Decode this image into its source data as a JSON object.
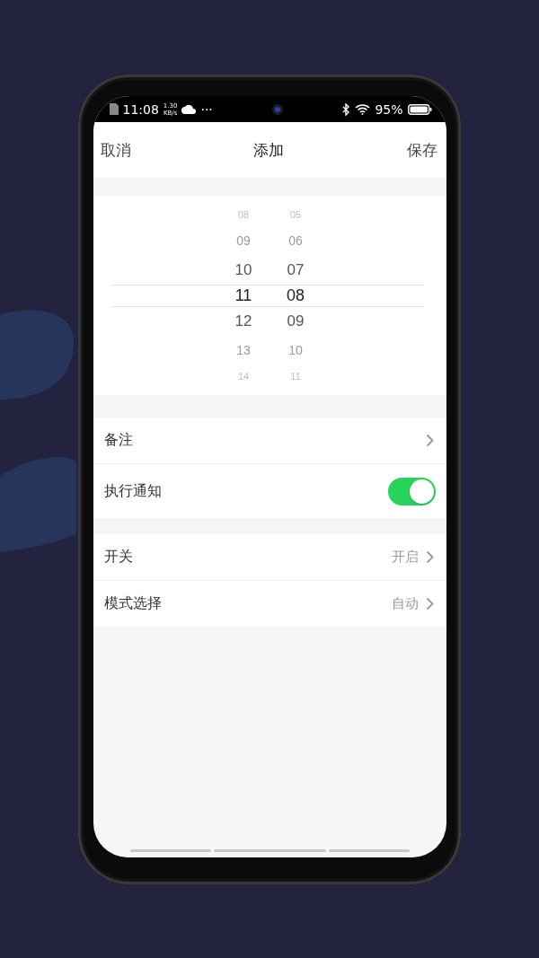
{
  "status_bar": {
    "time": "11:08",
    "speed": "1.30",
    "speed_unit": "KB/s",
    "more": "···",
    "battery": "95%"
  },
  "nav": {
    "left": "取消",
    "title": "添加",
    "right": "保存"
  },
  "picker": {
    "columns": [
      {
        "items": [
          {
            "label": "08",
            "selected": false
          },
          {
            "label": "09",
            "selected": false
          },
          {
            "label": "10",
            "selected": false
          },
          {
            "label": "11",
            "selected": true
          },
          {
            "label": "12",
            "selected": false
          },
          {
            "label": "13",
            "selected": false
          },
          {
            "label": "14",
            "selected": false
          }
        ]
      },
      {
        "items": [
          {
            "label": "05",
            "selected": false
          },
          {
            "label": "06",
            "selected": false
          },
          {
            "label": "07",
            "selected": false
          },
          {
            "label": "08",
            "selected": true
          },
          {
            "label": "09",
            "selected": false
          },
          {
            "label": "10",
            "selected": false
          },
          {
            "label": "11",
            "selected": false
          }
        ]
      }
    ]
  },
  "sections": [
    {
      "rows": [
        {
          "kind": "link",
          "label": "备注"
        },
        {
          "kind": "toggle",
          "label": "执行通知",
          "on": true
        }
      ]
    },
    {
      "rows": [
        {
          "kind": "link",
          "label": "开关",
          "value": "开启"
        },
        {
          "kind": "link",
          "label": "模式选择",
          "value": "自动"
        }
      ]
    }
  ]
}
